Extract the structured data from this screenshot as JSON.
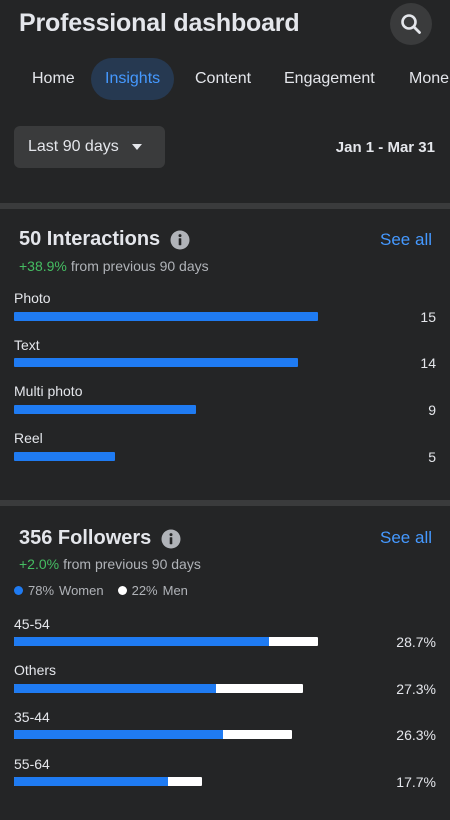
{
  "header": {
    "title": "Professional dashboard"
  },
  "tabs": [
    {
      "label": "Home",
      "active": false
    },
    {
      "label": "Insights",
      "active": true
    },
    {
      "label": "Content",
      "active": false
    },
    {
      "label": "Engagement",
      "active": false
    },
    {
      "label": "Mone",
      "active": false
    }
  ],
  "filter": {
    "range_label": "Last 90 days",
    "date_range": "Jan 1 - Mar 31"
  },
  "interactions": {
    "title": "50 Interactions",
    "see_all": "See all",
    "change": "+38.9%",
    "change_text": "from previous 90 days",
    "rows": [
      {
        "label": "Photo",
        "value": "15",
        "fraction": 1.0
      },
      {
        "label": "Text",
        "value": "14",
        "fraction": 0.933
      },
      {
        "label": "Multi photo",
        "value": "9",
        "fraction": 0.6
      },
      {
        "label": "Reel",
        "value": "5",
        "fraction": 0.333
      }
    ]
  },
  "followers": {
    "title": "356 Followers",
    "see_all": "See all",
    "change": "+2.0%",
    "change_text": "from previous 90 days",
    "legend": [
      {
        "pct": "78%",
        "label": "Women",
        "color": "#1f7bf2"
      },
      {
        "pct": "22%",
        "label": "Men",
        "color": "#ffffff"
      }
    ],
    "rows": [
      {
        "label": "45-54",
        "value": "28.7%",
        "total_fraction": 1.0,
        "women_fraction": 0.84
      },
      {
        "label": "Others",
        "value": "27.3%",
        "total_fraction": 0.951,
        "women_fraction": 0.7
      },
      {
        "label": "35-44",
        "value": "26.3%",
        "total_fraction": 0.916,
        "women_fraction": 0.75
      },
      {
        "label": "55-64",
        "value": "17.7%",
        "total_fraction": 0.617,
        "women_fraction": 0.82
      }
    ]
  },
  "colors": {
    "accent": "#4599ff",
    "bar": "#1f7bf2",
    "positive": "#45bd62",
    "background": "#242526"
  }
}
